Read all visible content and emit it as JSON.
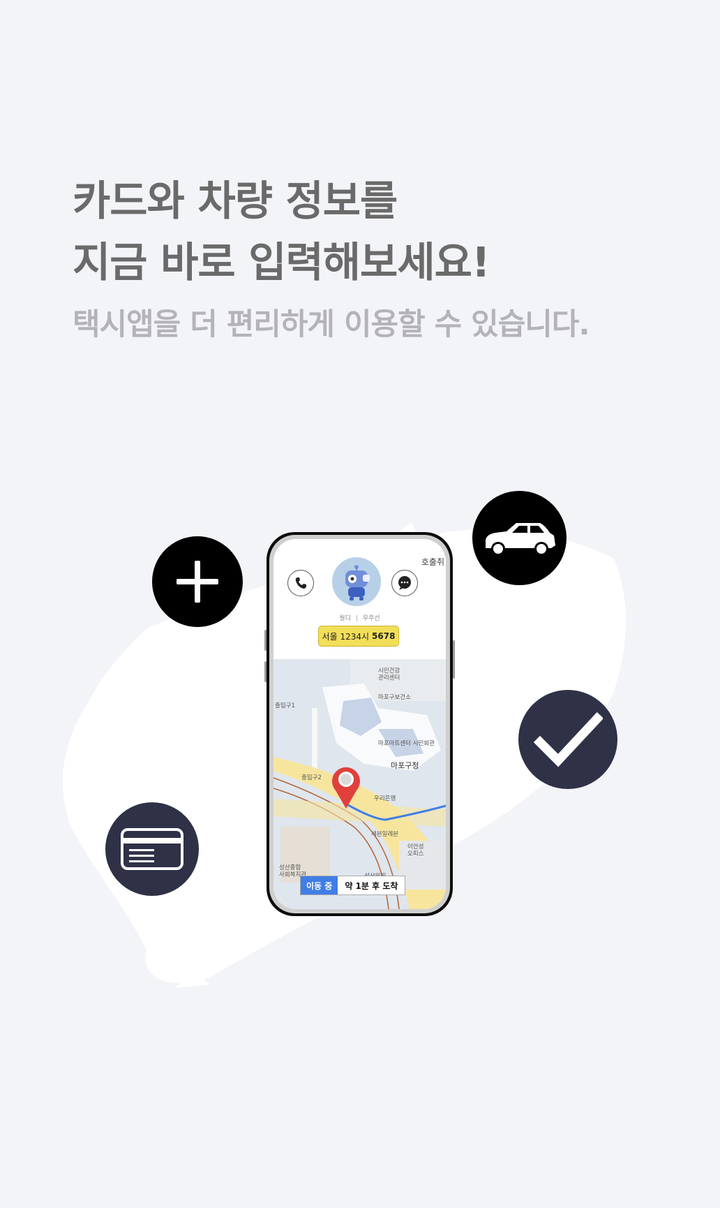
{
  "headline": {
    "line1": "카드와 차량 정보를",
    "line2": "지금 바로 입력해보세요!",
    "subtitle": "택시앱을 더 편리하게 이용할 수 있습니다."
  },
  "icons": {
    "plus": "plus-icon",
    "car": "car-icon",
    "check": "checkmark-icon",
    "card": "credit-card-icon"
  },
  "colors": {
    "background": "#f3f4f8",
    "headline": "#6a6a6a",
    "subtitle": "#b3b3b8",
    "icon_dark": "#2f3146",
    "plate_yellow": "#f2de58",
    "status_blue": "#3f7ee6",
    "pin_red": "#e0403c"
  },
  "phone": {
    "call_tag": "호출취",
    "driver_name": "월디",
    "car_model": "우주선",
    "plate_prefix": "서울 1234시",
    "plate_number": "5678",
    "status_moving": "이동 중",
    "status_eta": "약 1분 후 도착",
    "map_labels": {
      "health_center": "시민건강\n관리센터",
      "mapo_health": "마포구보건소",
      "exit1": "출입구1",
      "exit2": "출입구2",
      "civic_hall": "마포아트센터 시민회관",
      "mapo_office": "마포구청",
      "woori_bank": "우리은행",
      "seven_eleven": "세븐일레븐",
      "ian_officetel": "이안성\n오피스",
      "seongsan_welfare": "성산종합\n사회복지관",
      "seongsan_clinic": "성산의원"
    }
  }
}
